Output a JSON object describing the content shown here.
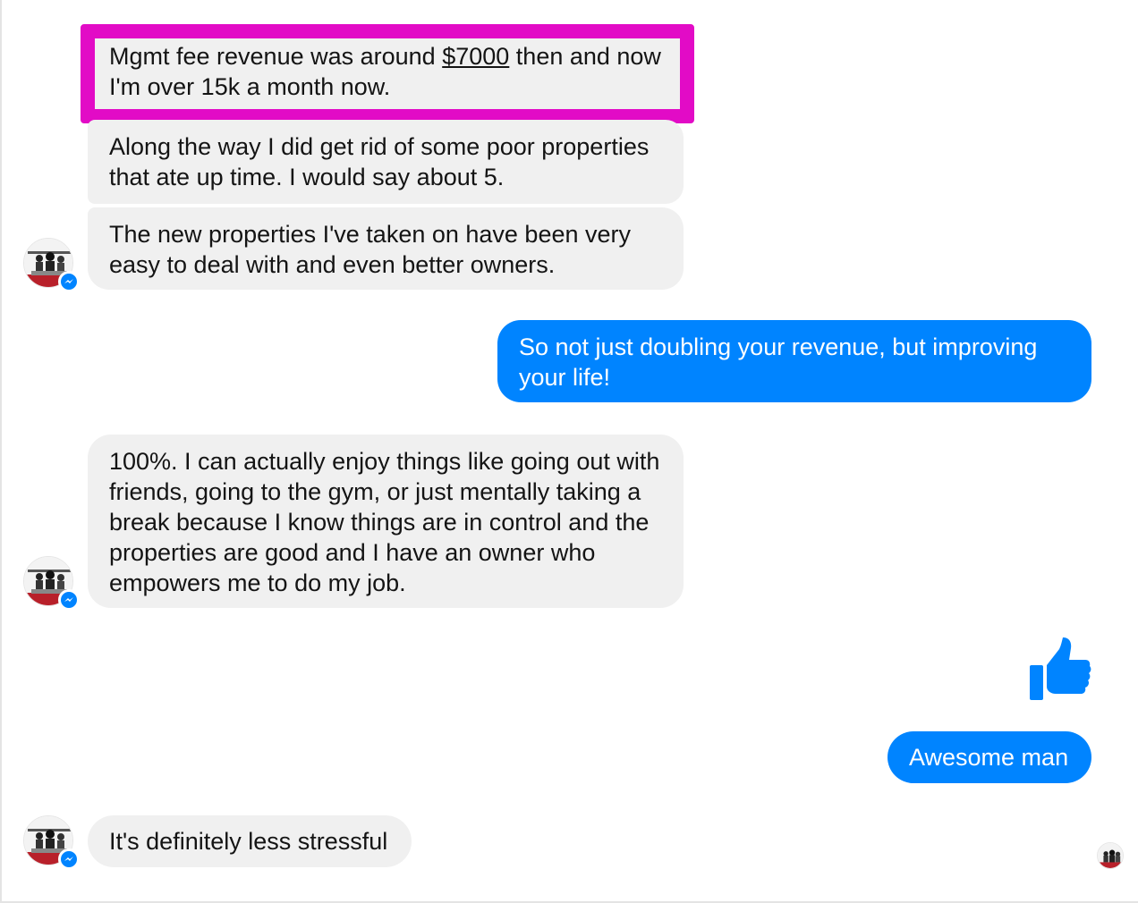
{
  "conversation": {
    "messages": [
      {
        "sender": "them",
        "parts": [
          "Mgmt fee revenue was around ",
          "$7000",
          " then and now I'm over 15k a month now."
        ],
        "highlighted": true
      },
      {
        "sender": "them",
        "text": "Along the way I did get rid of some poor properties that ate up time. I would say about 5."
      },
      {
        "sender": "them",
        "text": "The new properties I've taken on have been very easy to deal with and even better owners."
      },
      {
        "sender": "me",
        "text": "So not just doubling your revenue, but improving your life!"
      },
      {
        "sender": "them",
        "text": "100%. I can actually enjoy things like going out with friends, going to the gym, or just mentally taking a break because I know things are in control and the properties are good and I have an owner who empowers me to do my job."
      },
      {
        "sender": "me",
        "icon": "thumbs-up-icon"
      },
      {
        "sender": "me",
        "text": "Awesome man"
      },
      {
        "sender": "them",
        "text": "It's definitely less stressful"
      }
    ]
  },
  "colors": {
    "outgoing_bubble": "#0084ff",
    "incoming_bubble": "#f0f0f0",
    "highlight_border": "#e20bc6",
    "thumbs_up": "#0084ff"
  },
  "icons": {
    "avatar": "contact-avatar",
    "badge": "messenger-badge-icon",
    "like": "thumbs-up-icon",
    "seen": "seen-avatar"
  }
}
